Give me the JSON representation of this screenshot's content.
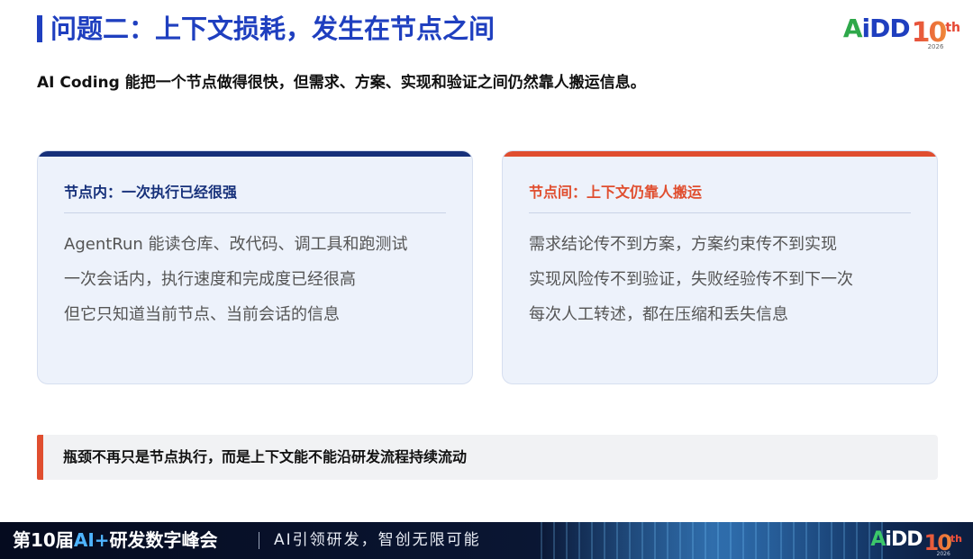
{
  "header": {
    "title": "问题二：上下文损耗，发生在节点之间",
    "subtitle": "AI Coding 能把一个节点做得很快，但需求、方案、实现和验证之间仍然靠人搬运信息。"
  },
  "logo": {
    "a": "A",
    "i_dd": "iDD",
    "ten": "10",
    "th": "th",
    "year": "2026"
  },
  "cards": {
    "left": {
      "heading": "节点内：一次执行已经很强",
      "lines": [
        "AgentRun 能读仓库、改代码、调工具和跑测试",
        "一次会话内，执行速度和完成度已经很高",
        "但它只知道当前节点、当前会话的信息"
      ]
    },
    "right": {
      "heading": "节点间：上下文仍靠人搬运",
      "lines": [
        "需求结论传不到方案，方案约束传不到实现",
        "实现风险传不到验证，失败经验传不到下一次",
        "每次人工转述，都在压缩和丢失信息"
      ]
    }
  },
  "conclusion": {
    "text": "瓶颈不再只是节点执行，而是上下文能不能沿研发流程持续流动"
  },
  "footer": {
    "conf_prefix": "第10届",
    "conf_accent": "AI+",
    "conf_suffix": "研发数字峰会",
    "slogan": "AI引领研发，智创无限可能"
  },
  "colors": {
    "title_blue": "#1f3fbf",
    "navy": "#16307a",
    "accent_red": "#e04e2f",
    "card_bg": "#edf2fb"
  }
}
